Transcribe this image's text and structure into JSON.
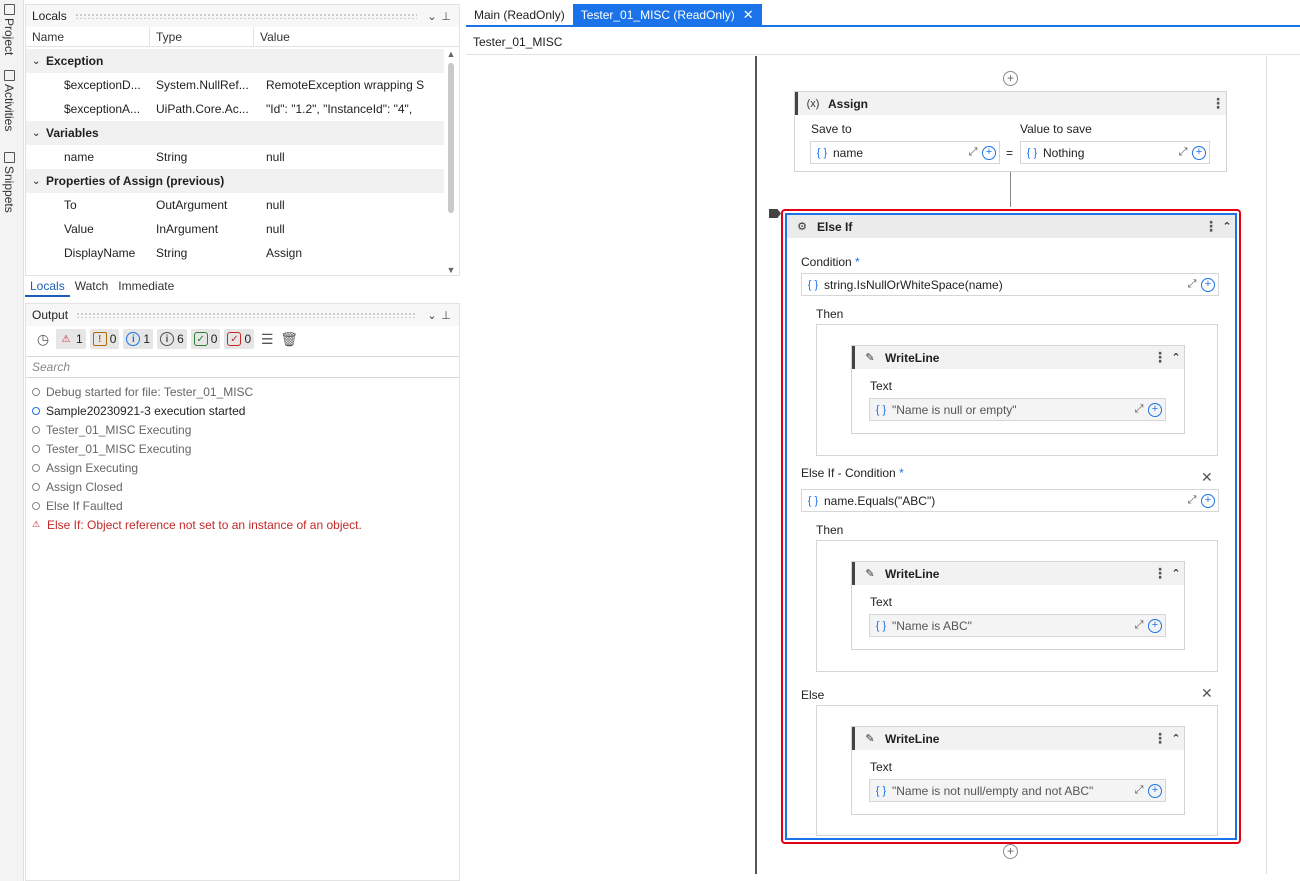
{
  "sidestrip": {
    "tabs": [
      "Project",
      "Activities",
      "Snippets"
    ]
  },
  "locals": {
    "title": "Locals",
    "columns": [
      "Name",
      "Type",
      "Value"
    ],
    "groups": [
      {
        "name": "Exception",
        "rows": [
          {
            "name": "$exceptionD...",
            "type": "System.NullRef...",
            "value": "RemoteException wrapping S"
          },
          {
            "name": "$exceptionA...",
            "type": "UiPath.Core.Ac...",
            "value": "\"Id\": \"1.2\",  \"InstanceId\": \"4\","
          }
        ]
      },
      {
        "name": "Variables",
        "rows": [
          {
            "name": "name",
            "type": "String",
            "value": "null"
          }
        ]
      },
      {
        "name": "Properties of Assign (previous)",
        "rows": [
          {
            "name": "To",
            "type": "OutArgument",
            "value": "null"
          },
          {
            "name": "Value",
            "type": "InArgument",
            "value": "null"
          },
          {
            "name": "DisplayName",
            "type": "String",
            "value": "Assign"
          }
        ]
      }
    ]
  },
  "subtabs": [
    "Locals",
    "Watch",
    "Immediate"
  ],
  "output": {
    "title": "Output",
    "filters": {
      "errors": "1",
      "warnings": "0",
      "info": "1",
      "trace": "6",
      "success": "0",
      "failed": "0"
    },
    "search_placeholder": "Search",
    "lines": [
      {
        "text": "Debug started for file: Tester_01_MISC",
        "level": "trace"
      },
      {
        "text": "Sample20230921-3 execution started",
        "level": "info"
      },
      {
        "text": "Tester_01_MISC Executing",
        "level": "trace"
      },
      {
        "text": "Tester_01_MISC Executing",
        "level": "trace"
      },
      {
        "text": "Assign Executing",
        "level": "trace"
      },
      {
        "text": "Assign Closed",
        "level": "trace"
      },
      {
        "text": "Else If Faulted",
        "level": "trace"
      },
      {
        "text": "Else If: Object reference not set to an instance of an object.",
        "level": "error"
      }
    ]
  },
  "designer": {
    "tabs": [
      {
        "label": "Main (ReadOnly)",
        "active": false
      },
      {
        "label": "Tester_01_MISC (ReadOnly)",
        "active": true
      }
    ],
    "breadcrumb": "Tester_01_MISC",
    "assign": {
      "title": "Assign",
      "save_to_label": "Save to",
      "value_label": "Value to save",
      "save_to": "name",
      "equals": "=",
      "value": "Nothing"
    },
    "elseif": {
      "title": "Else If",
      "condition_label": "Condition",
      "condition": "string.IsNullOrWhiteSpace(name)",
      "then_label": "Then",
      "writeline1": {
        "title": "WriteLine",
        "text_label": "Text",
        "text": "\"Name is null or empty\""
      },
      "elseif_condition_label": "Else If - Condition",
      "elseif_condition": "name.Equals(\"ABC\")",
      "then2_label": "Then",
      "writeline2": {
        "title": "WriteLine",
        "text_label": "Text",
        "text": "\"Name is ABC\""
      },
      "else_label": "Else",
      "writeline3": {
        "title": "WriteLine",
        "text_label": "Text",
        "text": "\"Name is not null/empty and not ABC\""
      },
      "required_mark": "*"
    }
  }
}
